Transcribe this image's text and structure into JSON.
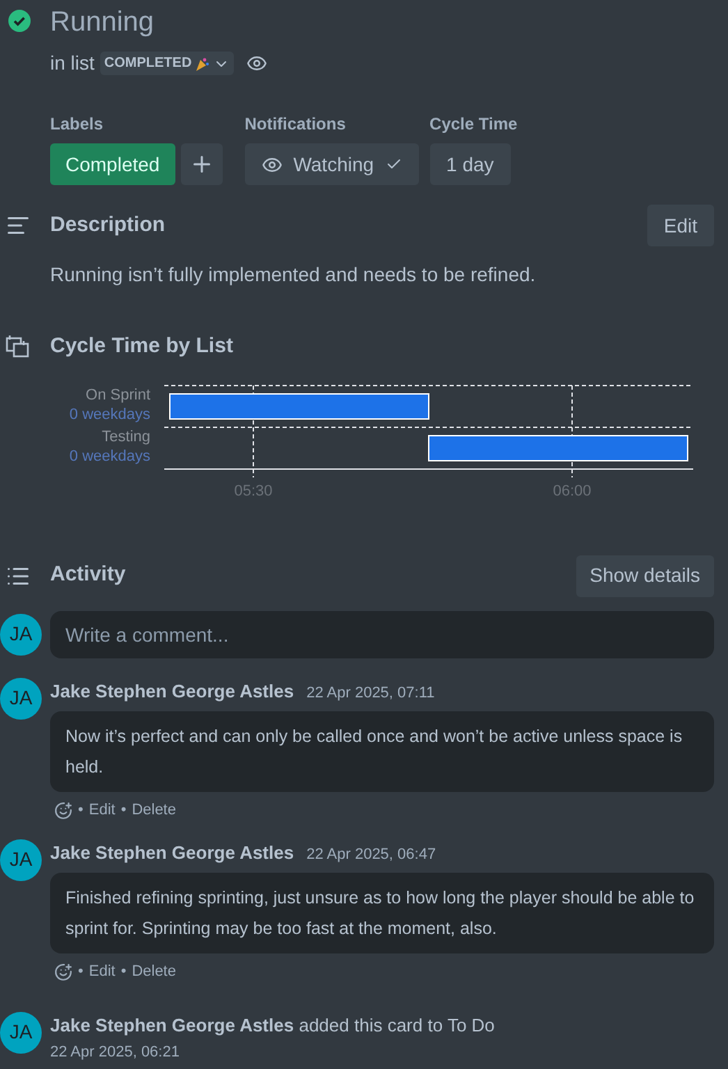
{
  "card": {
    "title": "Running",
    "completed": true,
    "list_prefix": "in list",
    "list_name": "COMPLETED",
    "watching_visible": true
  },
  "fields": {
    "labels": {
      "heading": "Labels",
      "items": [
        {
          "text": "Completed",
          "color": "#1f845a"
        }
      ]
    },
    "notifications": {
      "heading": "Notifications",
      "value": "Watching",
      "checked": true
    },
    "cycle_time": {
      "heading": "Cycle Time",
      "value": "1 day"
    }
  },
  "description": {
    "heading": "Description",
    "edit_button": "Edit",
    "text": "Running isn’t fully implemented and needs to be refined."
  },
  "cycle_time_by_list": {
    "heading": "Cycle Time by List",
    "rows": [
      {
        "name": "On Sprint",
        "duration": "0 weekdays"
      },
      {
        "name": "Testing",
        "duration": "0 weekdays"
      }
    ],
    "ticks": [
      "05:30",
      "06:00"
    ]
  },
  "activity": {
    "heading": "Activity",
    "details_button": "Show details",
    "comment_placeholder": "Write a comment...",
    "avatar": "JA",
    "entries": [
      {
        "kind": "comment",
        "avatar": "JA",
        "author": "Jake Stephen George Astles",
        "time": "22 Apr 2025, 07:11",
        "text": "Now it’s perfect and can only be called once and won’t be active unless space is held.",
        "actions": [
          "•",
          "Edit",
          "•",
          "Delete"
        ]
      },
      {
        "kind": "comment",
        "avatar": "JA",
        "author": "Jake Stephen George Astles",
        "time": "22 Apr 2025, 06:47",
        "text": "Finished refining sprinting, just unsure as to how long the player should be able to sprint for. Sprinting may be too fast at the moment, also.",
        "actions": [
          "•",
          "Edit",
          "•",
          "Delete"
        ]
      },
      {
        "kind": "event",
        "avatar": "JA",
        "author": "Jake Stephen George Astles",
        "text": "added this card to To Do",
        "time": "22 Apr 2025, 06:21"
      }
    ]
  }
}
